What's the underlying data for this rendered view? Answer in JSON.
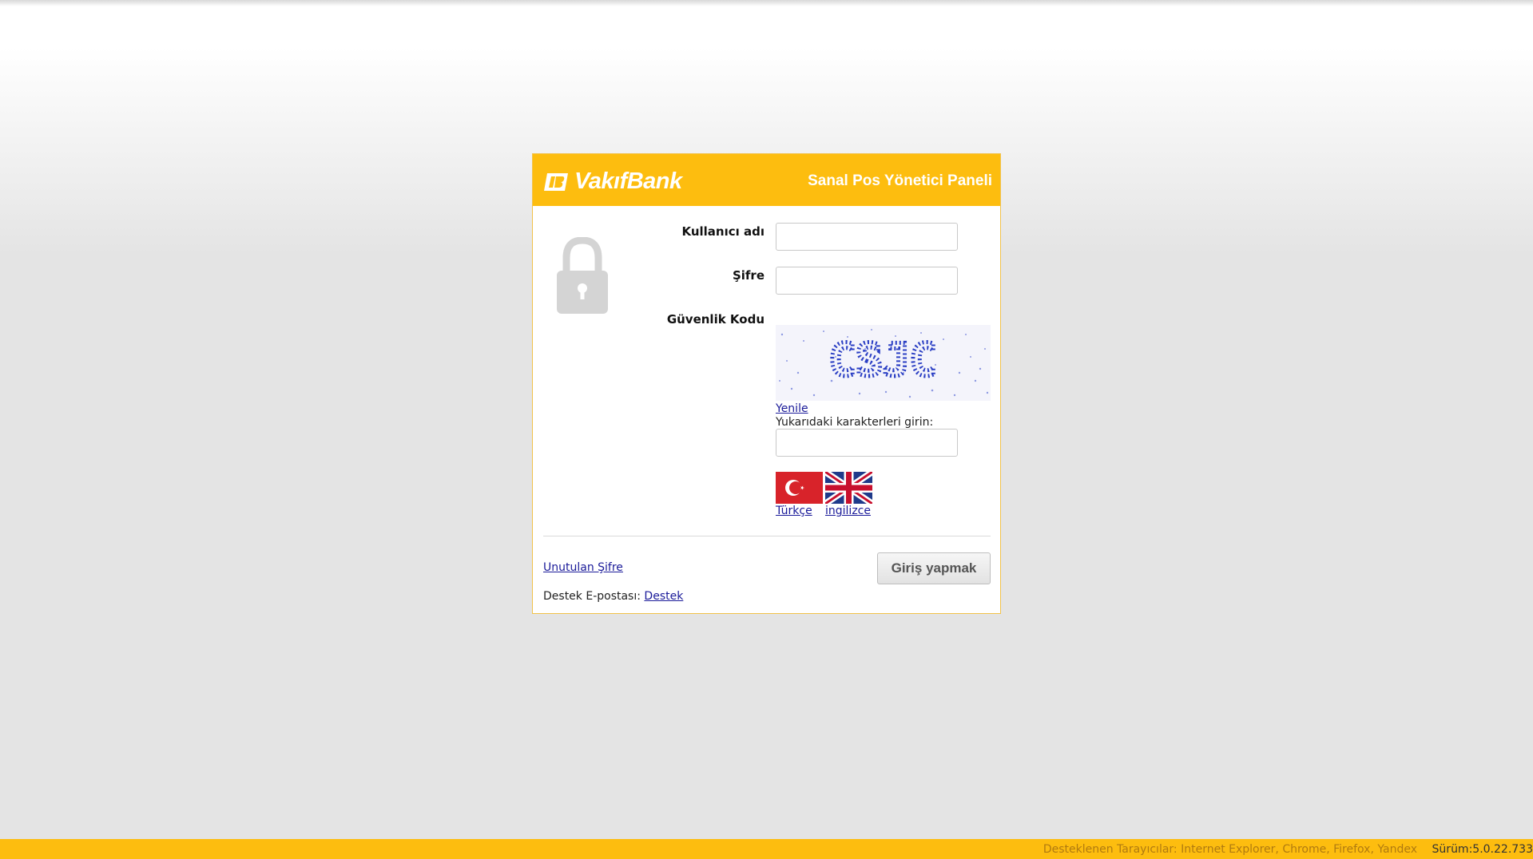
{
  "header": {
    "brand": "VakıfBank",
    "panel_title": "Sanal Pos Yönetici Paneli"
  },
  "form": {
    "username_label": "Kullanıcı adı",
    "username_value": "",
    "password_label": "Şifre",
    "password_value": "",
    "security_label": "Güvenlik Kodu",
    "captcha_text": "CSJC",
    "refresh_link": "Yenile",
    "captcha_instruction": "Yukarıdaki karakterleri girin:",
    "captcha_value": ""
  },
  "languages": {
    "turkish": "Türkçe",
    "english": "ingilizce"
  },
  "bottom": {
    "forgot_password": "Unutulan Şifre",
    "support_label": "Destek E-postası:",
    "support_link": "Destek",
    "login_button": "Giriş yapmak"
  },
  "footer": {
    "supported_browsers": "Desteklenen Tarayıcılar: Internet Explorer, Chrome, Firefox, Yandex",
    "version": "Sürüm:5.0.22.733"
  },
  "colors": {
    "brand_yellow": "#fdbd0f",
    "link_blue": "#1a1a99"
  },
  "icons": {
    "logo": "vakifbank-logo-mark",
    "lock": "lock-icon",
    "tr_flag": "turkey-flag-icon",
    "uk_flag": "uk-flag-icon"
  }
}
